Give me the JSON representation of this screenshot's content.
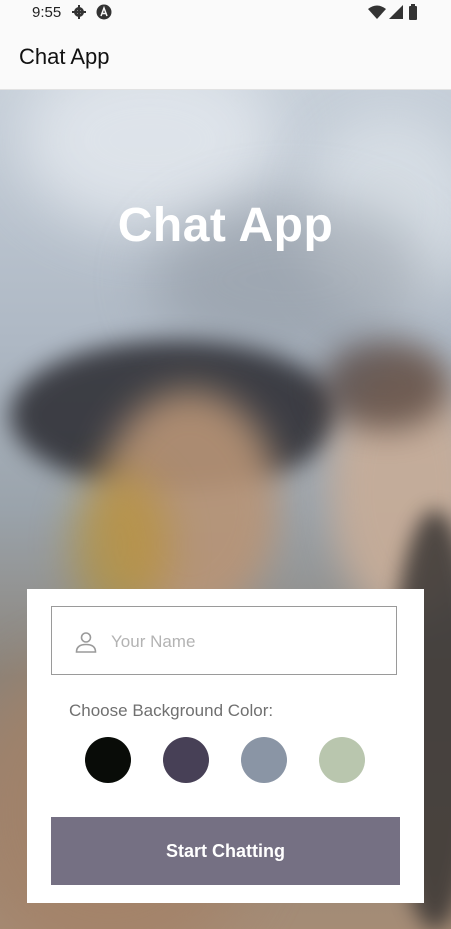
{
  "status_bar": {
    "time": "9:55",
    "icons": [
      "gear-icon",
      "a-circle-icon",
      "wifi-icon",
      "signal-icon",
      "battery-icon"
    ]
  },
  "app_bar": {
    "title": "Chat App"
  },
  "hero": {
    "title": "Chat App"
  },
  "form": {
    "name_placeholder": "Your Name",
    "name_value": "",
    "choose_label": "Choose Background Color:",
    "colors": [
      "#090C08",
      "#474056",
      "#8A95A5",
      "#B9C6AE"
    ],
    "start_label": "Start Chatting",
    "button_color": "#757083"
  }
}
